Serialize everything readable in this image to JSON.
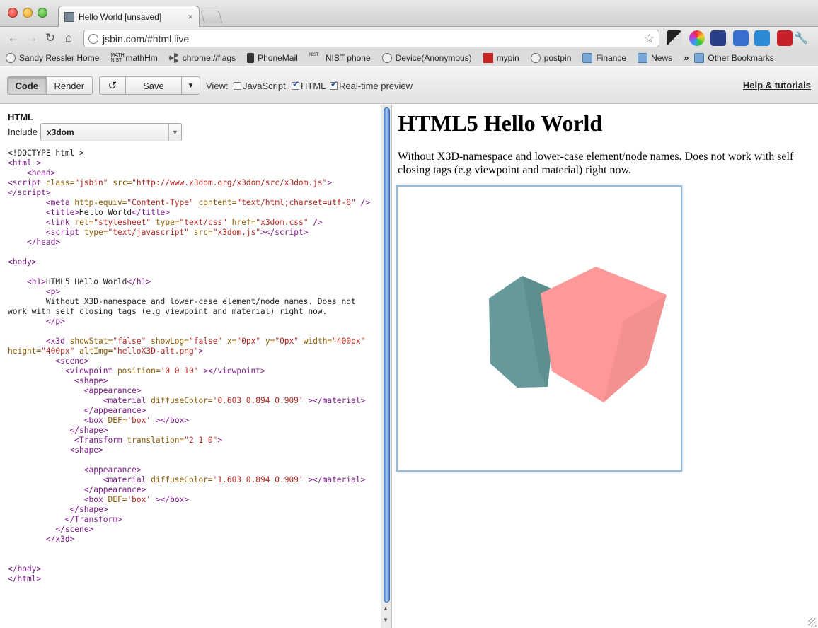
{
  "browser": {
    "tab_title": "Hello World [unsaved]",
    "tab_close": "×",
    "url": "jsbin.com/#html,live",
    "nav": {
      "back": "←",
      "forward": "→",
      "reload": "↻",
      "home": "⌂",
      "star": "☆",
      "wrench": "🔧"
    },
    "bookmarks": [
      {
        "label": "Sandy Ressler Home",
        "icon": "globe-icon"
      },
      {
        "label": "mathHm",
        "icon": "math-icon"
      },
      {
        "label": "chrome://flags",
        "icon": "radiation-icon"
      },
      {
        "label": "PhoneMail",
        "icon": "phone-icon"
      },
      {
        "label": "NIST phone",
        "icon": "nist-icon"
      },
      {
        "label": "Device(Anonymous)",
        "icon": "globe-icon"
      },
      {
        "label": "mypin",
        "icon": "red-icon"
      },
      {
        "label": "postpin",
        "icon": "globe-icon"
      },
      {
        "label": "Finance",
        "icon": "folder-icon"
      },
      {
        "label": "News",
        "icon": "folder-icon"
      }
    ],
    "bookmarks_overflow": "»",
    "other_bookmarks": "Other Bookmarks",
    "math_icon_text": "MATH\nNIST",
    "nist_icon_text": "NIST"
  },
  "jsbin": {
    "code_label": "Code",
    "render_label": "Render",
    "revert_glyph": "↺",
    "save_label": "Save",
    "save_menu_glyph": "▼",
    "view_label": "View:",
    "checkboxes": [
      {
        "label": "JavaScript",
        "checked": false
      },
      {
        "label": "HTML",
        "checked": true
      },
      {
        "label": "Real-time preview",
        "checked": true
      }
    ],
    "help_label": "Help & tutorials"
  },
  "editor": {
    "title": "HTML",
    "include_label": "Include",
    "include_value": "x3dom",
    "include_arrow": "▼"
  },
  "preview": {
    "heading": "HTML5 Hello World",
    "intro": "Without X3D-namespace and lower-case element/node names. Does not work with self closing tags (e.g viewpoint and material) right now.",
    "colors": {
      "teal_cube": "#669999",
      "pink_cube": "#ff9999",
      "pink_cube_shadow": "#f08a8a",
      "frame_border": "#9ab8d8"
    }
  }
}
